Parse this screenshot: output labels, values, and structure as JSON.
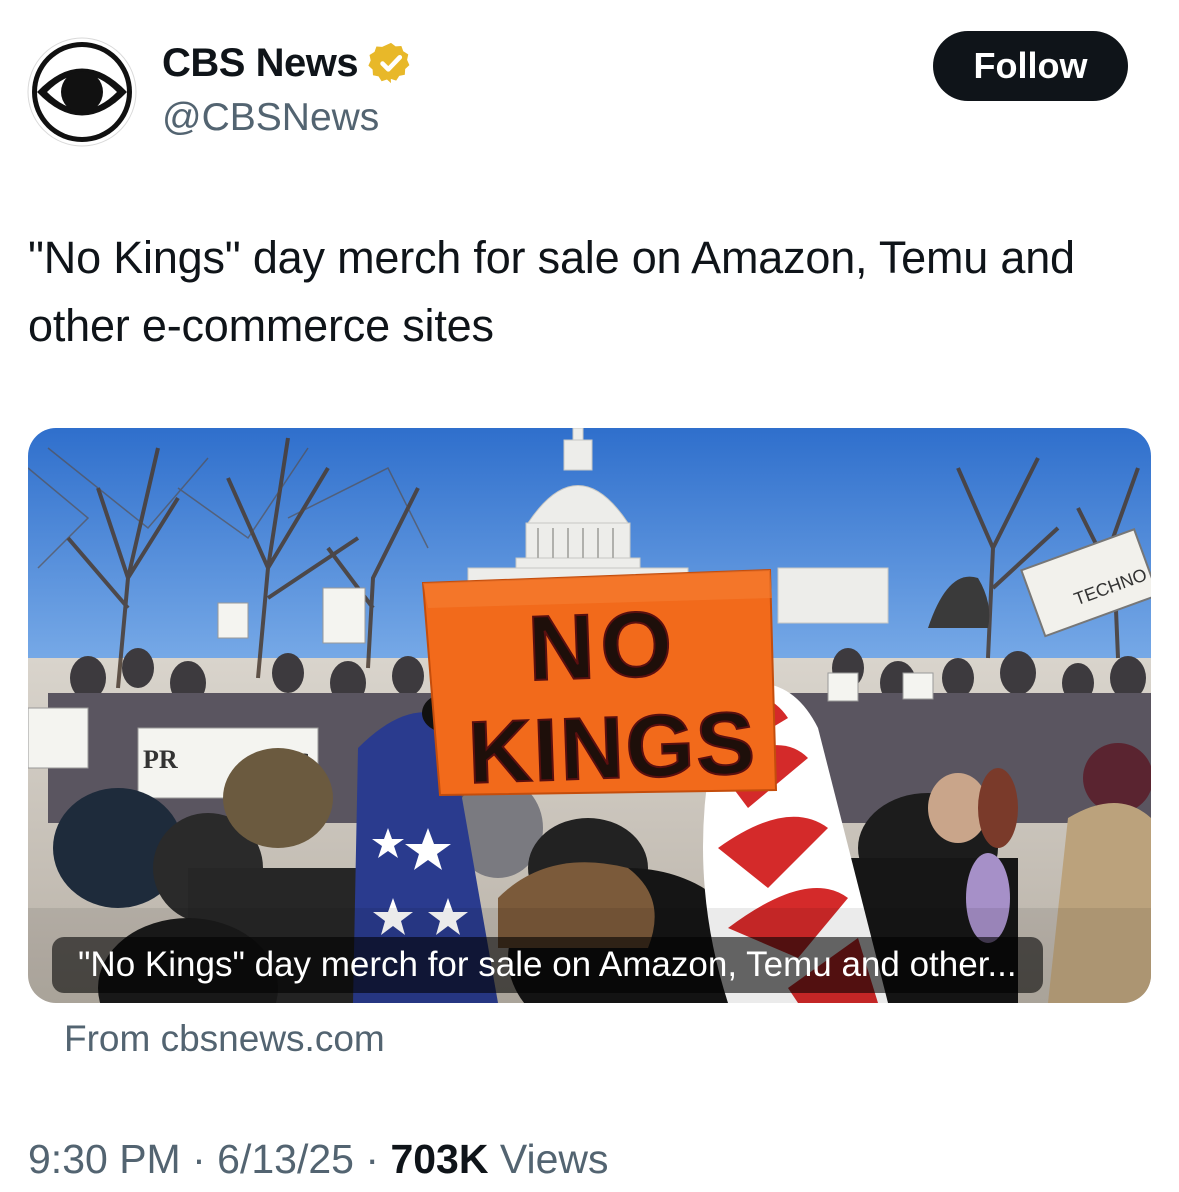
{
  "account": {
    "display_name": "CBS News",
    "handle": "@CBSNews",
    "avatar_icon": "cbs-eye-logo",
    "verified_icon": "gold-verified-badge",
    "verified_color": "#E8B829"
  },
  "follow_button": {
    "label": "Follow"
  },
  "tweet": {
    "text": "\"No Kings\" day merch for sale on Amazon, Temu and other e-commerce sites"
  },
  "link_card": {
    "caption": "\"No Kings\" day merch for sale on Amazon, Temu and other...",
    "source": "From cbsnews.com",
    "sign_text": "NO KINGS",
    "secondary_sign_text": "TECHNO"
  },
  "meta": {
    "time": "9:30 PM",
    "date": "6/13/25",
    "separator": "·",
    "views_count": "703K",
    "views_label": "Views"
  },
  "colors": {
    "text_primary": "#0f1419",
    "text_secondary": "#536471",
    "button_bg": "#0f1419",
    "sign_orange": "#F26A1B",
    "sky_blue": "#3E7FD6"
  }
}
